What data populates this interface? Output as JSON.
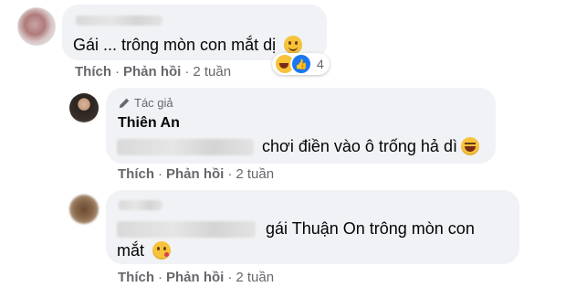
{
  "comments": [
    {
      "author_name": "",
      "text": "Gái ... trông mòn con mắt dị",
      "emoji": "grinning-face",
      "reactions": {
        "types": [
          "laughing-face-icon",
          "like-icon"
        ],
        "count": "4"
      },
      "actions": {
        "like": "Thích",
        "reply": "Phản hồi",
        "time": "2 tuần"
      }
    },
    {
      "author_tag": "Tác giả",
      "author_name": "Thiên An",
      "text": "chơi điền vào ô trống hả dì",
      "emoji": "tears-of-joy-face",
      "actions": {
        "like": "Thích",
        "reply": "Phản hồi",
        "time": "2 tuần"
      }
    },
    {
      "author_name": "",
      "text": "gái Thuận On trông mòn con",
      "text_line2": "mắt",
      "emoji": "kissing-face",
      "actions": {
        "like": "Thích",
        "reply": "Phản hồi",
        "time": "2 tuần"
      }
    }
  ],
  "separator": "·",
  "colors": {
    "bubble": "#f0f2f5",
    "meta_text": "#65676b",
    "like_blue": "#1877f2"
  }
}
